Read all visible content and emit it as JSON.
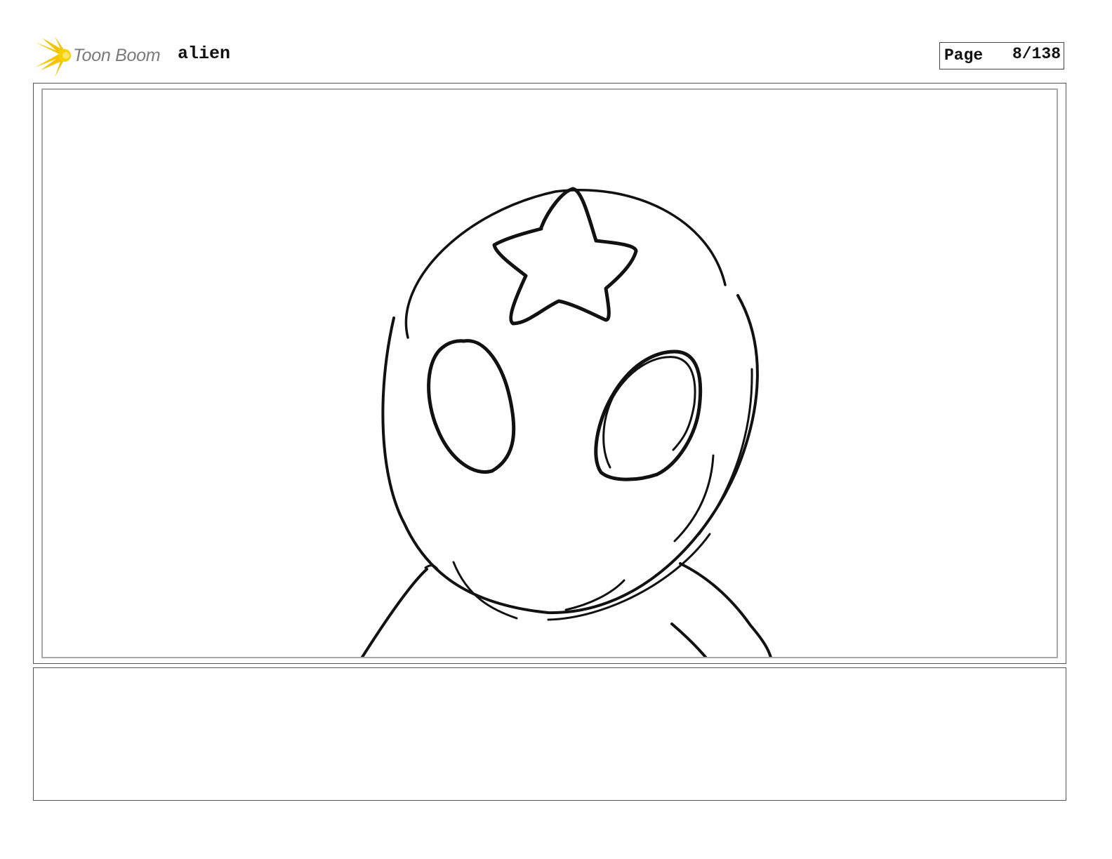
{
  "header": {
    "logo_text": "Toon Boom",
    "project_title": "alien",
    "page_label": "Page",
    "page_number": "8/138"
  },
  "panel": {
    "drawing": "alien-head-sketch-icon"
  },
  "notes": {
    "text": ""
  }
}
